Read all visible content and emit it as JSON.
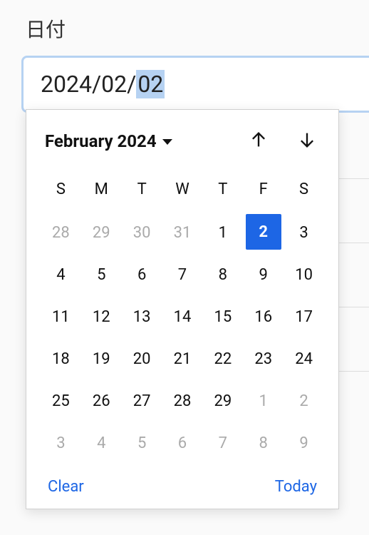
{
  "field": {
    "label": "日付",
    "value_prefix": "2024/02/",
    "value_highlighted": "02"
  },
  "datepicker": {
    "month_label": "February 2024",
    "weekdays": [
      "S",
      "M",
      "T",
      "W",
      "T",
      "F",
      "S"
    ],
    "days": [
      {
        "n": "28",
        "muted": true,
        "selected": false
      },
      {
        "n": "29",
        "muted": true,
        "selected": false
      },
      {
        "n": "30",
        "muted": true,
        "selected": false
      },
      {
        "n": "31",
        "muted": true,
        "selected": false
      },
      {
        "n": "1",
        "muted": false,
        "selected": false
      },
      {
        "n": "2",
        "muted": false,
        "selected": true
      },
      {
        "n": "3",
        "muted": false,
        "selected": false
      },
      {
        "n": "4",
        "muted": false,
        "selected": false
      },
      {
        "n": "5",
        "muted": false,
        "selected": false
      },
      {
        "n": "6",
        "muted": false,
        "selected": false
      },
      {
        "n": "7",
        "muted": false,
        "selected": false
      },
      {
        "n": "8",
        "muted": false,
        "selected": false
      },
      {
        "n": "9",
        "muted": false,
        "selected": false
      },
      {
        "n": "10",
        "muted": false,
        "selected": false
      },
      {
        "n": "11",
        "muted": false,
        "selected": false
      },
      {
        "n": "12",
        "muted": false,
        "selected": false
      },
      {
        "n": "13",
        "muted": false,
        "selected": false
      },
      {
        "n": "14",
        "muted": false,
        "selected": false
      },
      {
        "n": "15",
        "muted": false,
        "selected": false
      },
      {
        "n": "16",
        "muted": false,
        "selected": false
      },
      {
        "n": "17",
        "muted": false,
        "selected": false
      },
      {
        "n": "18",
        "muted": false,
        "selected": false
      },
      {
        "n": "19",
        "muted": false,
        "selected": false
      },
      {
        "n": "20",
        "muted": false,
        "selected": false
      },
      {
        "n": "21",
        "muted": false,
        "selected": false
      },
      {
        "n": "22",
        "muted": false,
        "selected": false
      },
      {
        "n": "23",
        "muted": false,
        "selected": false
      },
      {
        "n": "24",
        "muted": false,
        "selected": false
      },
      {
        "n": "25",
        "muted": false,
        "selected": false
      },
      {
        "n": "26",
        "muted": false,
        "selected": false
      },
      {
        "n": "27",
        "muted": false,
        "selected": false
      },
      {
        "n": "28",
        "muted": false,
        "selected": false
      },
      {
        "n": "29",
        "muted": false,
        "selected": false
      },
      {
        "n": "1",
        "muted": true,
        "selected": false
      },
      {
        "n": "2",
        "muted": true,
        "selected": false
      },
      {
        "n": "3",
        "muted": true,
        "selected": false
      },
      {
        "n": "4",
        "muted": true,
        "selected": false
      },
      {
        "n": "5",
        "muted": true,
        "selected": false
      },
      {
        "n": "6",
        "muted": true,
        "selected": false
      },
      {
        "n": "7",
        "muted": true,
        "selected": false
      },
      {
        "n": "8",
        "muted": true,
        "selected": false
      },
      {
        "n": "9",
        "muted": true,
        "selected": false
      }
    ],
    "actions": {
      "clear": "Clear",
      "today": "Today"
    }
  }
}
